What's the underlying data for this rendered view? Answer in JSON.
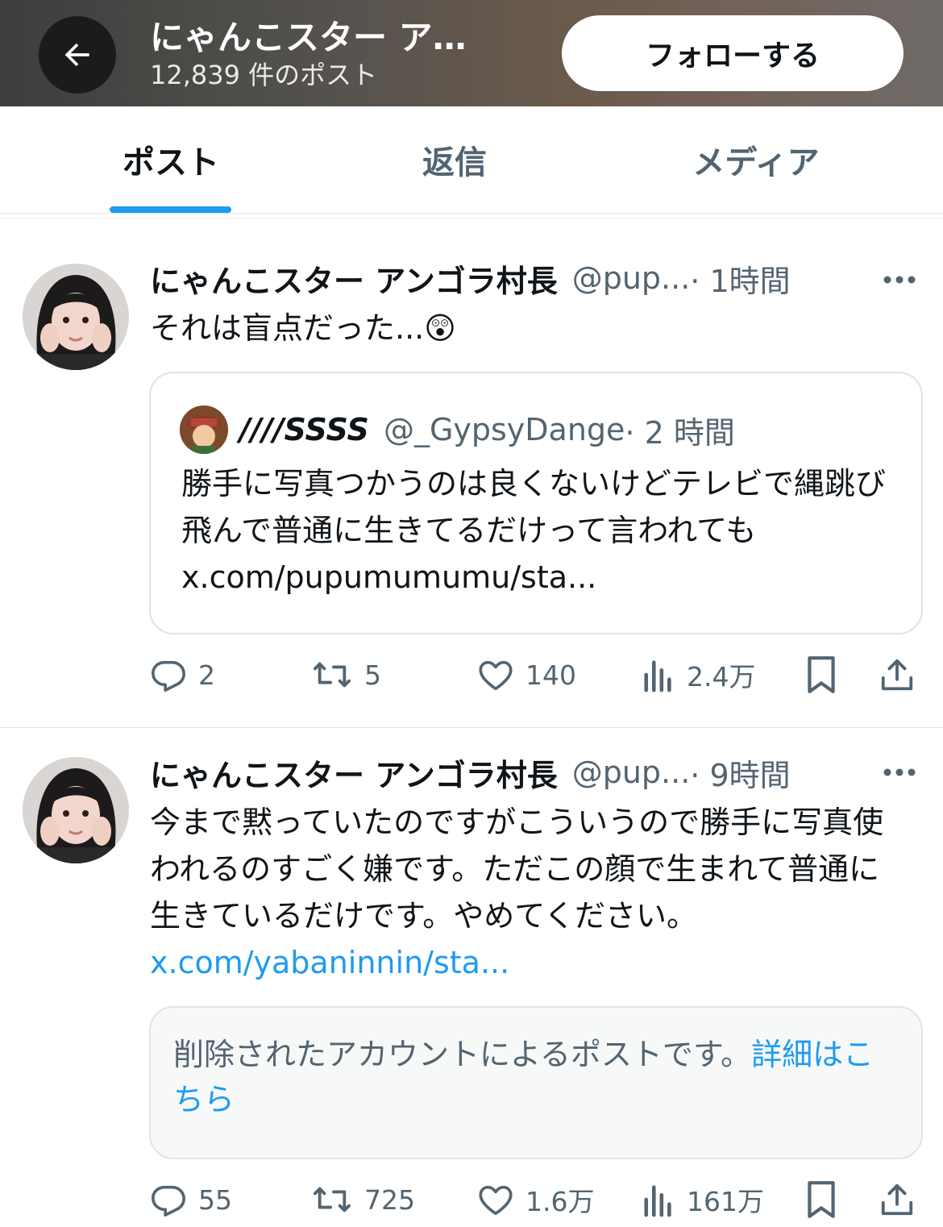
{
  "header": {
    "title": "にゃんこスター ア…",
    "post_count": "12,839 件のポスト",
    "follow_label": "フォローする"
  },
  "tabs": [
    {
      "label": "ポスト",
      "active": true
    },
    {
      "label": "返信",
      "active": false
    },
    {
      "label": "メディア",
      "active": false
    }
  ],
  "posts": [
    {
      "name": "にゃんこスター アンゴラ村長",
      "handle": "@pup...",
      "time": "· 1時間",
      "text": "それは盲点だった...",
      "emoji": "😲",
      "quote": {
        "name": "////SSSS",
        "handle": "@_GypsyDange",
        "time": "· 2 時間",
        "text": "勝手に写真つかうのは良くないけどテレビで縄跳び飛んで普通に生きてるだけって言われても x.com/pupumumumu/sta..."
      },
      "replies": "2",
      "reposts": "5",
      "likes": "140",
      "views": "2.4万"
    },
    {
      "name": "にゃんこスター アンゴラ村長",
      "handle": "@pup...",
      "time": "· 9時間",
      "text": "今まで黙っていたのですがこういうので勝手に写真使われるのすごく嫌です。ただこの顔で生まれて普通に生きているだけです。やめてください。",
      "link": "x.com/yabaninnin/sta...",
      "deleted_text": "削除されたアカウントによるポストです。",
      "deleted_link": "詳細はこちら",
      "replies": "55",
      "reposts": "725",
      "likes": "1.6万",
      "views": "161万"
    }
  ],
  "colors": {
    "accent": "#1d9bf0",
    "secondary_text": "#536471",
    "primary_text": "#0f1419"
  },
  "icons": [
    "back-arrow-icon",
    "more-icon",
    "reply-icon",
    "repost-icon",
    "like-icon",
    "views-icon",
    "bookmark-icon",
    "share-icon"
  ]
}
